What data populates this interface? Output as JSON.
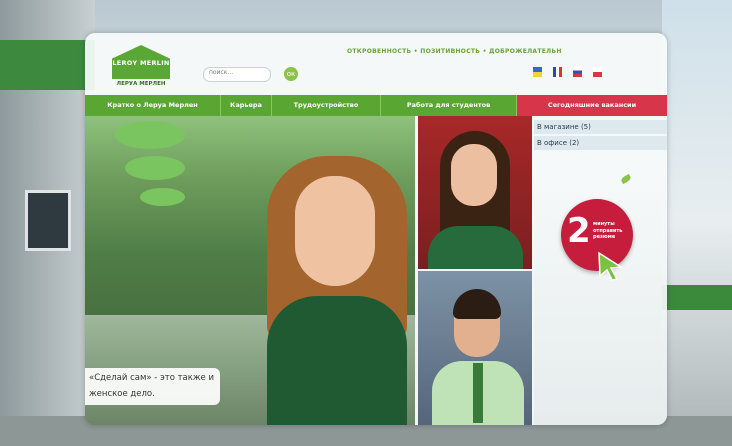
{
  "logo": {
    "brand": "LEROY MERLIN",
    "subtitle": "ЛЕРУА МЕРЛЕН"
  },
  "slogan": "ОТКРОВЕННОСТЬ  •  ПОЗИТИВНОСТЬ  •  ДОБРОЖЕЛАТЕЛЬН",
  "search": {
    "placeholder": "поиск...",
    "button": "ок"
  },
  "languages": [
    "ua",
    "fr",
    "ru",
    "pl"
  ],
  "nav": {
    "items": [
      {
        "label": "Кратко о Леруа Мерлен"
      },
      {
        "label": "Карьера"
      },
      {
        "label": "Трудоустройство"
      },
      {
        "label": "Работа для студентов"
      },
      {
        "label": "Сегодняшние вакансии"
      }
    ]
  },
  "vacancies": [
    {
      "label": "В магазине (5)"
    },
    {
      "label": "В офисе (2)"
    }
  ],
  "badge": {
    "number": "2",
    "text": "минуты отправить резюме"
  },
  "caption": {
    "line1": "«Сделай сам» - это также и",
    "line2": "женское дело."
  },
  "colors": {
    "brand_green": "#5aa633",
    "accent_red": "#d6354a",
    "badge_red": "#c51d3b"
  }
}
